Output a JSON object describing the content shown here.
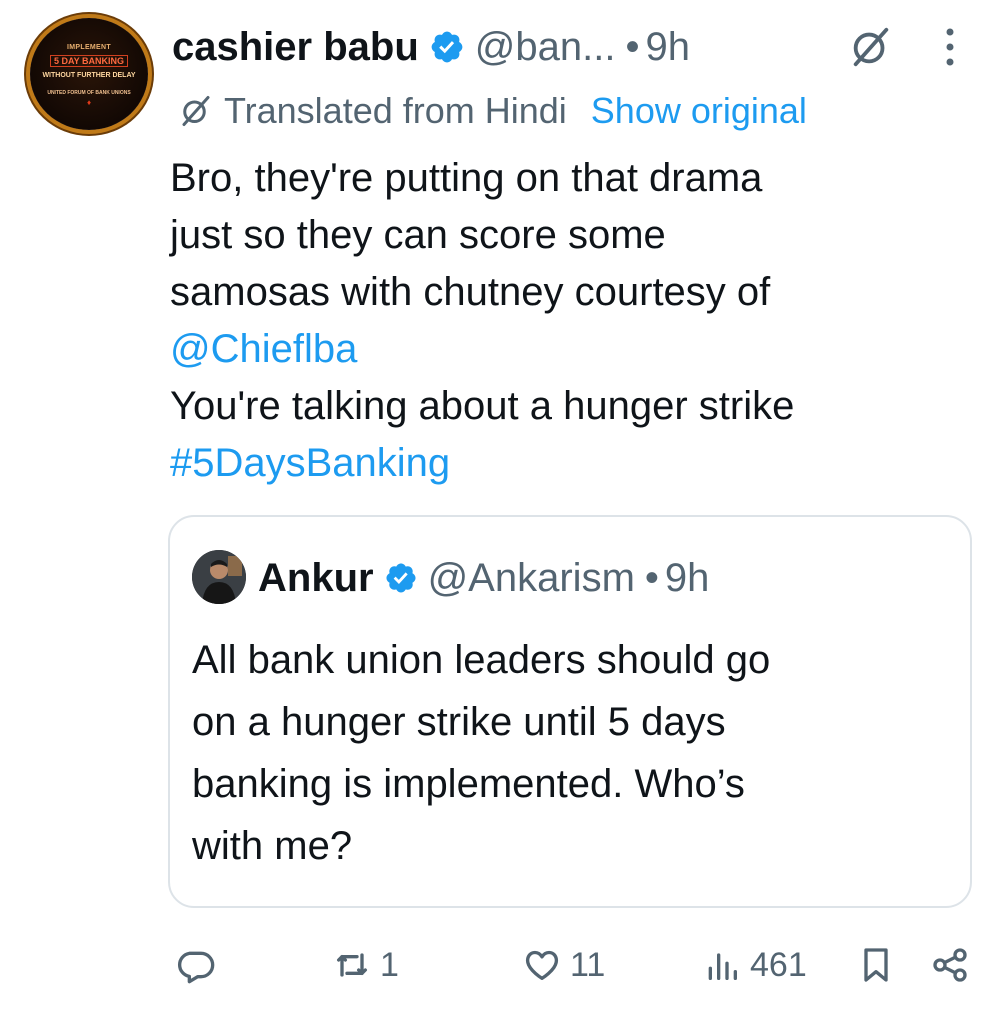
{
  "tweet": {
    "author_name": "cashier babu",
    "author_handle": "@ban...",
    "separator": "•",
    "time": "9h",
    "avatar_text": [
      "IMPLEMENT",
      "5 DAY BANKING",
      "WITHOUT FURTHER DELAY",
      "UNITED FORUM OF BANK UNIONS",
      "♦"
    ],
    "translation": {
      "label": "Translated from Hindi",
      "show_original": "Show original"
    },
    "lines": [
      "Bro, they're putting on that drama",
      "just so they can score some",
      "samosas with chutney courtesy of"
    ],
    "mention": "@Chieflba",
    "line_after_mention": "You're talking about a hunger strike",
    "hashtag": "#5DaysBanking"
  },
  "quote": {
    "author_name": "Ankur",
    "author_handle": "@Ankarism",
    "separator": "•",
    "time": "9h",
    "lines": [
      "All bank union leaders should go",
      "on a hunger strike until 5 days",
      "banking is implemented. Who’s",
      "with me?"
    ]
  },
  "actions": {
    "replies": "",
    "reposts": "1",
    "likes": "11",
    "views": "461"
  },
  "icons": [
    "verified-badge-icon",
    "grok-icon",
    "more-icon",
    "translate-icon",
    "reply-icon",
    "repost-icon",
    "like-icon",
    "views-icon",
    "bookmark-icon",
    "share-icon"
  ],
  "colors": {
    "accent": "#1d9bf0",
    "secondary_text": "#536471",
    "text": "#0f1419",
    "border": "#dde3e8"
  }
}
